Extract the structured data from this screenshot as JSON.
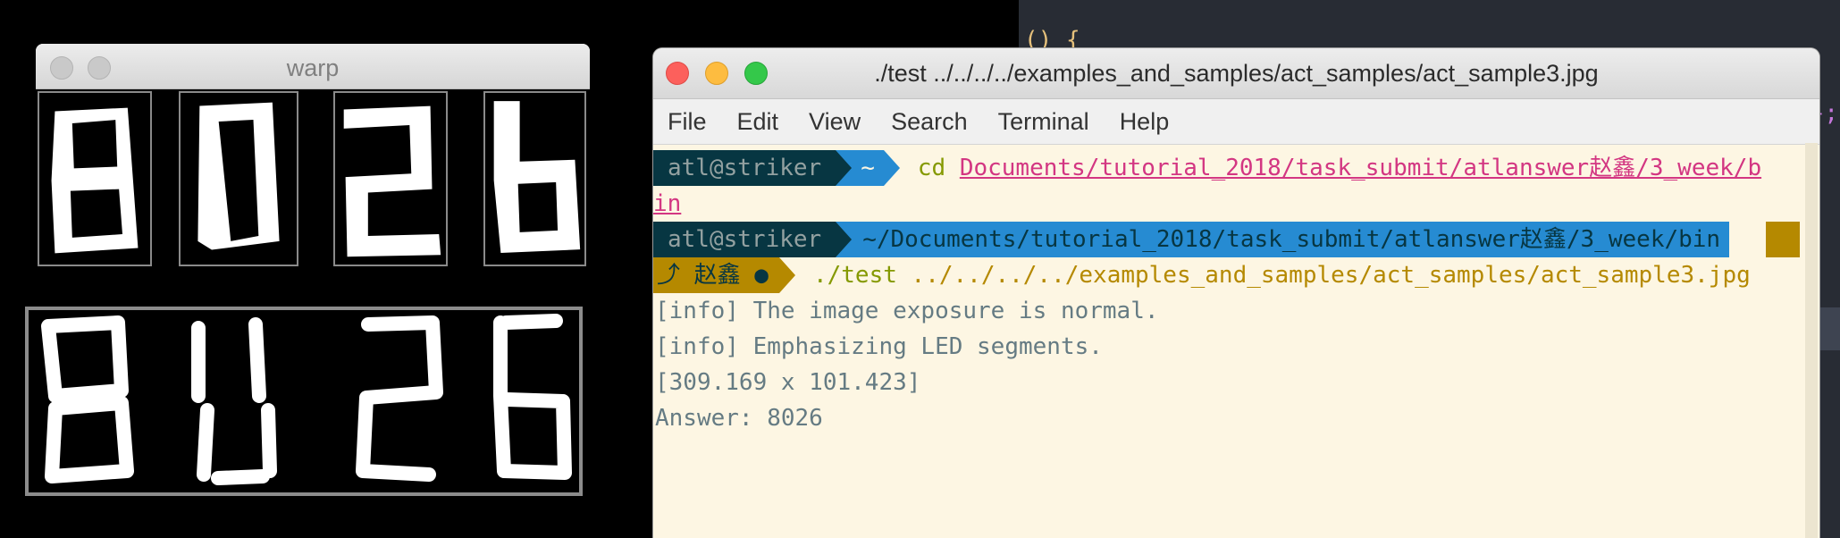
{
  "editor": {
    "fragment_left": "() {",
    "fragment_right": "};"
  },
  "warp_window": {
    "title": "warp",
    "digits": [
      "8",
      "0",
      "2",
      "6"
    ]
  },
  "camera_image": {
    "digits": [
      "8",
      "0",
      "2",
      "6"
    ]
  },
  "terminal": {
    "title": "./test ../../../../examples_and_samples/act_samples/act_sample3.jpg",
    "menu": [
      "File",
      "Edit",
      "View",
      "Search",
      "Terminal",
      "Help"
    ],
    "prompt1": {
      "user": "atl@striker",
      "dir": "~",
      "command": "cd",
      "path_part1": "Documents/tutorial_2018/task_submit/atlanswer赵鑫/3_week/b",
      "path_part2": "in"
    },
    "prompt2": {
      "user": "atl@striker",
      "dir": "~/Documents/tutorial_2018/task_submit/atlanswer赵鑫/3_week/bin",
      "git_branch": "⤴ 赵鑫 ●",
      "command": "./test",
      "args": "../../../../examples_and_samples/act_samples/act_sample3.jpg"
    },
    "output": [
      "[info] The image exposure is normal.",
      "[info] Emphasizing LED segments.",
      "[309.169 x 101.423]",
      "Answer: 8026"
    ]
  },
  "colors": {
    "base3": "#fdf6e3",
    "base02": "#073642",
    "blue": "#268bd2",
    "yellow": "#b58900",
    "green": "#859900",
    "magenta": "#d33682"
  }
}
